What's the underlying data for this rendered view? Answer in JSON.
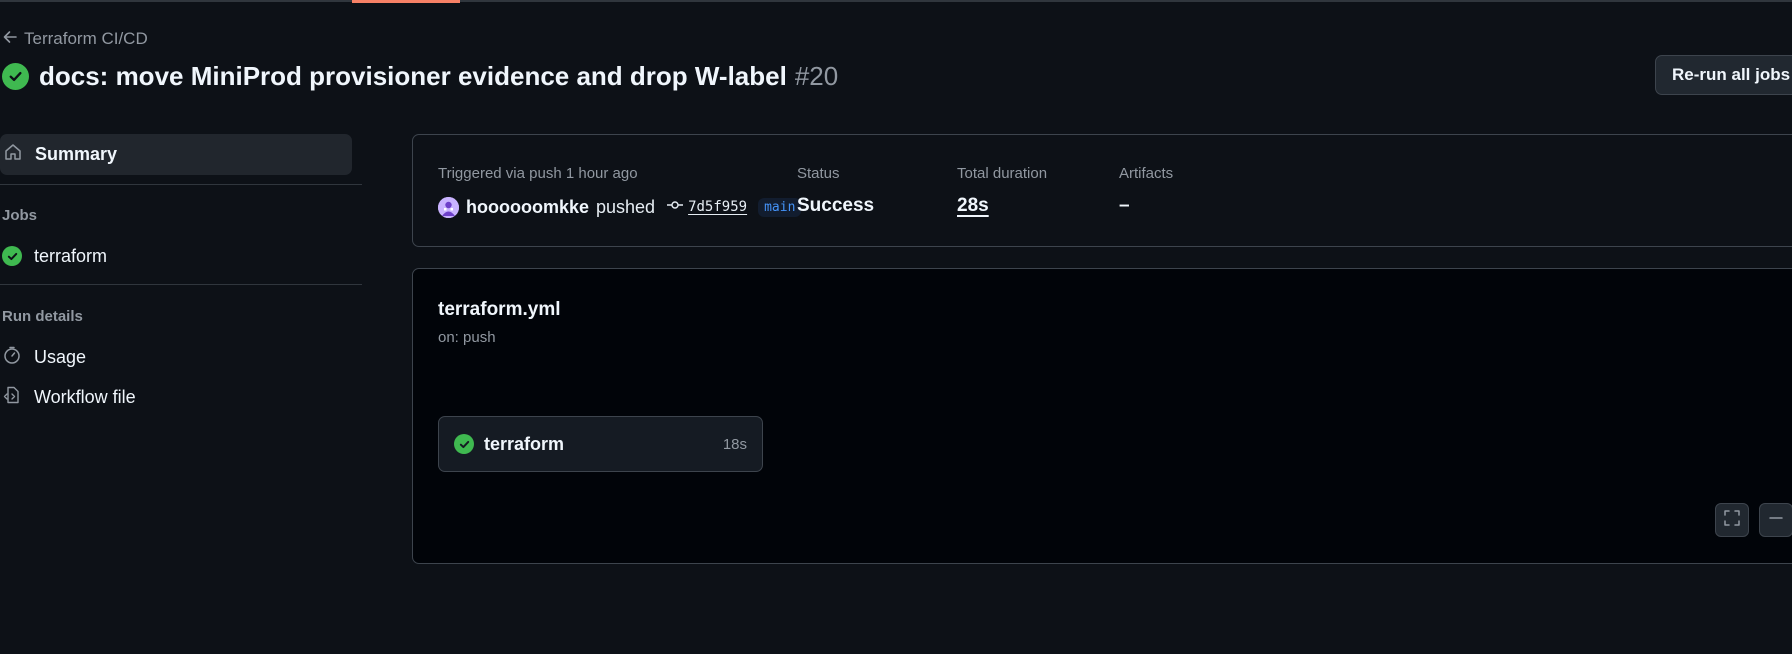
{
  "header": {
    "back_label": "Terraform CI/CD",
    "run_title": "docs: move MiniProd provisioner evidence and drop W-label",
    "run_number": "#20",
    "rerun_label": "Re-run all jobs"
  },
  "sidebar": {
    "summary_label": "Summary",
    "jobs_section": "Jobs",
    "jobs": [
      {
        "label": "terraform",
        "status": "success"
      }
    ],
    "run_details_section": "Run details",
    "usage_label": "Usage",
    "workflow_file_label": "Workflow file"
  },
  "summary": {
    "triggered_label": "Triggered via push 1 hour ago",
    "actor": "hoooooomkke",
    "action": "pushed",
    "commit_sha": "7d5f959",
    "branch": "main",
    "status_label": "Status",
    "status_value": "Success",
    "duration_label": "Total duration",
    "duration_value": "28s",
    "artifacts_label": "Artifacts",
    "artifacts_value": "–"
  },
  "workflow": {
    "file_name": "terraform.yml",
    "trigger": "on: push",
    "job_name": "terraform",
    "job_duration": "18s"
  },
  "colors": {
    "background": "#0d1117",
    "success": "#3fb950",
    "accent_link": "#4493f8",
    "muted_text": "#9198a1"
  },
  "icons": [
    "arrow-left-icon",
    "check-circle-icon",
    "home-icon",
    "stopwatch-icon",
    "workflow-file-icon",
    "commit-icon",
    "fullscreen-icon",
    "zoom-out-icon"
  ]
}
